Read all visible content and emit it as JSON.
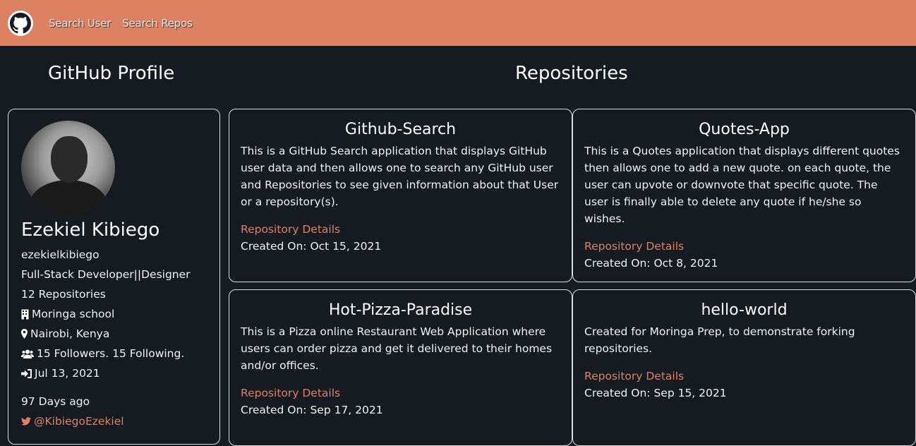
{
  "nav": {
    "logo_icon": "github-icon",
    "links": [
      "Search User",
      "Search Repos"
    ]
  },
  "headings": {
    "profile": "GitHub Profile",
    "repos": "Repositories"
  },
  "profile": {
    "name": "Ezekiel Kibiego",
    "username": "ezekielkibiego",
    "bio": "Full-Stack Developer||Designer",
    "repos": "12 Repositories",
    "company": "Moringa school",
    "location": "Nairobi, Kenya",
    "follow": "15 Followers. 15 Following.",
    "joined": "Jul 13, 2021",
    "days_ago": "97 Days ago",
    "twitter": "@KibiegoEzekiel"
  },
  "repositories": [
    {
      "name": "Github-Search",
      "description": "This is a GitHub Search application that displays GitHub user data and then allows one to search any GitHub user and Repositories to see given information about that User or a repository(s).",
      "link": "Repository Details",
      "created": "Created On: Oct 15, 2021"
    },
    {
      "name": "Quotes-App",
      "description": "This is a Quotes application that displays different quotes then allows one to add a new quote. on each quote, the user can upvote or downvote that specific quote. The user is finally able to delete any quote if he/she so wishes.",
      "link": "Repository Details",
      "created": "Created On: Oct 8, 2021"
    },
    {
      "name": "Hot-Pizza-Paradise",
      "description": "This is a Pizza online Restaurant Web Application where users can order pizza and get it delivered to their homes and/or offices.",
      "link": "Repository Details",
      "created": "Created On: Sep 17, 2021"
    },
    {
      "name": "hello-world",
      "description": "Created for Moringa Prep, to demonstrate forking repositories.",
      "link": "Repository Details",
      "created": "Created On: Sep 15, 2021"
    }
  ],
  "colors": {
    "navbar": "#dd8163",
    "background": "#161b22",
    "accent": "#dd8163"
  }
}
